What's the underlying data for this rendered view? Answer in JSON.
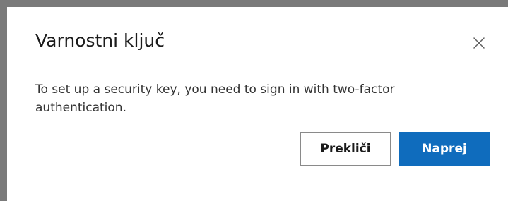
{
  "dialog": {
    "title": "Varnostni ključ",
    "body": "To set up a security key, you need to sign in with two-factor authentication.",
    "close_icon": "close-icon",
    "cancel_label": "Prekliči",
    "next_label": "Naprej"
  },
  "colors": {
    "primary": "#0f6cbd",
    "background_overlay": "#7a7a7a"
  }
}
